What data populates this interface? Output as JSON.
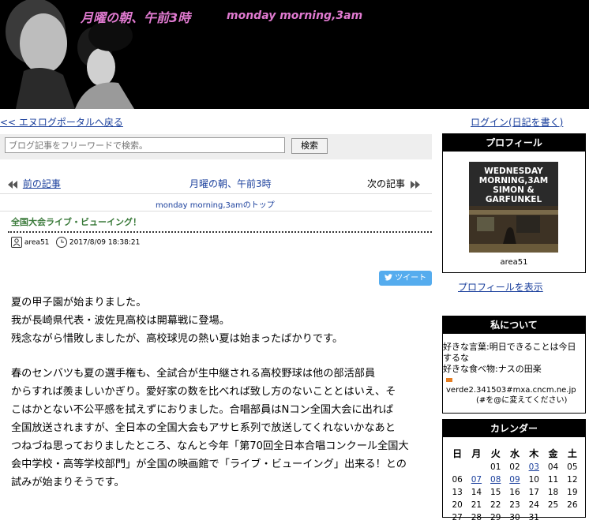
{
  "header": {
    "title": "月曜の朝、午前3時",
    "subtitle": "monday  morning,3am"
  },
  "top_links": {
    "portal": "<< エヌログポータルへ戻る",
    "login": "ログイン(日記を書く)"
  },
  "search": {
    "placeholder": "ブログ記事をフリーワードで検索。",
    "button": "検索"
  },
  "article_nav": {
    "prev": "前の記事",
    "center": "月曜の朝、午前3時",
    "next": "次の記事",
    "top_link": "monday  morning,3amのトップ"
  },
  "entry": {
    "title": "全国大会ライブ・ビューイング！",
    "author": "area51",
    "datetime": "2017/8/09 18:38:21",
    "tweet": "ツイート",
    "paragraphs": [
      [
        "夏の甲子園が始まりました。",
        "我が長崎県代表・波佐見高校は開幕戦に登場。",
        "残念ながら惜敗しましたが、高校球児の熱い夏は始まったばかりです。"
      ],
      [
        "春のセンバツも夏の選手権も、全試合が生中継される高校野球は他の部活部員",
        "からすれば羨ましいかぎり。愛好家の数を比べれば致し方のないこととはいえ、そ",
        "こはかとない不公平感を拭えずにおりました。合唱部員はNコン全国大会に出れば",
        "全国放送されますが、全日本の全国大会もアサヒ系列で放送してくれないかなあと",
        "つねづね思っておりましたところ、なんと今年「第70回全日本合唱コンクール全国大",
        "会中学校・高等学校部門」が全国の映画館で「ライブ・ビューイング」出来る！との",
        "試みが始まりそうです。"
      ]
    ]
  },
  "sidebar": {
    "profile": {
      "heading": "プロフィール",
      "album_lines": [
        "WEDNESDAY",
        "MORNING,3AM",
        "SIMON &",
        "GARFUNKEL"
      ],
      "name": "area51",
      "link": "プロフィールを表示"
    },
    "about": {
      "heading": "私について",
      "lines": [
        "好きな言葉:明日できることは今日",
        "するな",
        "好きな食べ物:ナスの田楽"
      ],
      "mail": "verde2.341503#mxa.cncm.ne.jp",
      "mail_note": "(#を@に変えてください)"
    },
    "calendar": {
      "heading": "カレンダー",
      "weekdays": [
        "日",
        "月",
        "火",
        "水",
        "木",
        "金",
        "土"
      ],
      "weeks": [
        [
          "",
          "",
          "01",
          "02",
          "03",
          "04",
          "05"
        ],
        [
          "06",
          "07",
          "08",
          "09",
          "10",
          "11",
          "12"
        ],
        [
          "13",
          "14",
          "15",
          "16",
          "17",
          "18",
          "19"
        ],
        [
          "20",
          "21",
          "22",
          "23",
          "24",
          "25",
          "26"
        ],
        [
          "27",
          "28",
          "29",
          "30",
          "31",
          "",
          ""
        ]
      ],
      "linked_days": [
        "03",
        "07",
        "08",
        "09"
      ]
    }
  },
  "colors": {
    "title_pink": "#e07ad0",
    "link_blue": "#1a3f9c",
    "entry_green": "#3a7a3a",
    "tweet_blue": "#55acee"
  }
}
